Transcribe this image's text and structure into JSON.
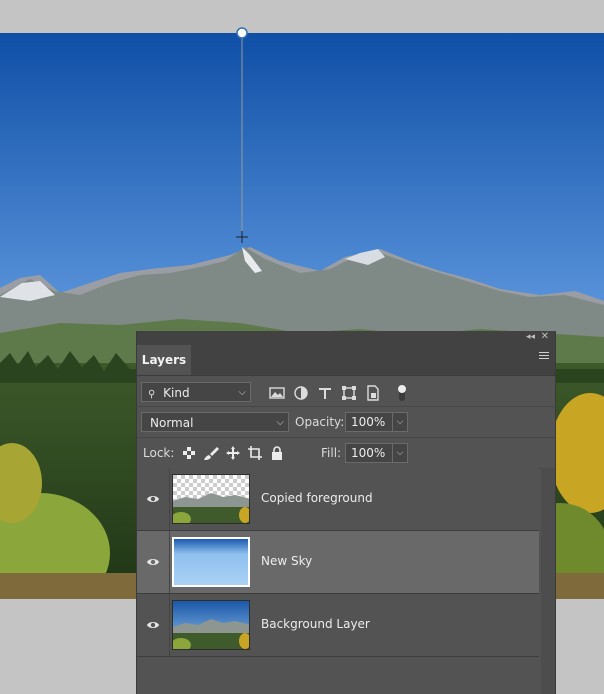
{
  "colors": {
    "sky_top": "#0f4fa6",
    "sky_bottom": "#9cc8f0",
    "panel_bg": "#535353",
    "panel_dark": "#424242",
    "selected_row": "#696969"
  },
  "panel": {
    "tab_label": "Layers",
    "filter": {
      "kind_label": "Kind",
      "icons": [
        "image-filter-icon",
        "adjustment-filter-icon",
        "type-filter-icon",
        "shape-filter-icon",
        "smart-object-filter-icon",
        "filter-toggle-icon"
      ]
    },
    "blend_mode": "Normal",
    "opacity_label": "Opacity:",
    "opacity_value": "100%",
    "lock_label": "Lock:",
    "fill_label": "Fill:",
    "fill_value": "100%",
    "layers": [
      {
        "name": "Copied foreground",
        "selected": false,
        "visible": true
      },
      {
        "name": "New Sky",
        "selected": true,
        "visible": true
      },
      {
        "name": "Background Layer",
        "selected": false,
        "visible": true
      }
    ]
  }
}
